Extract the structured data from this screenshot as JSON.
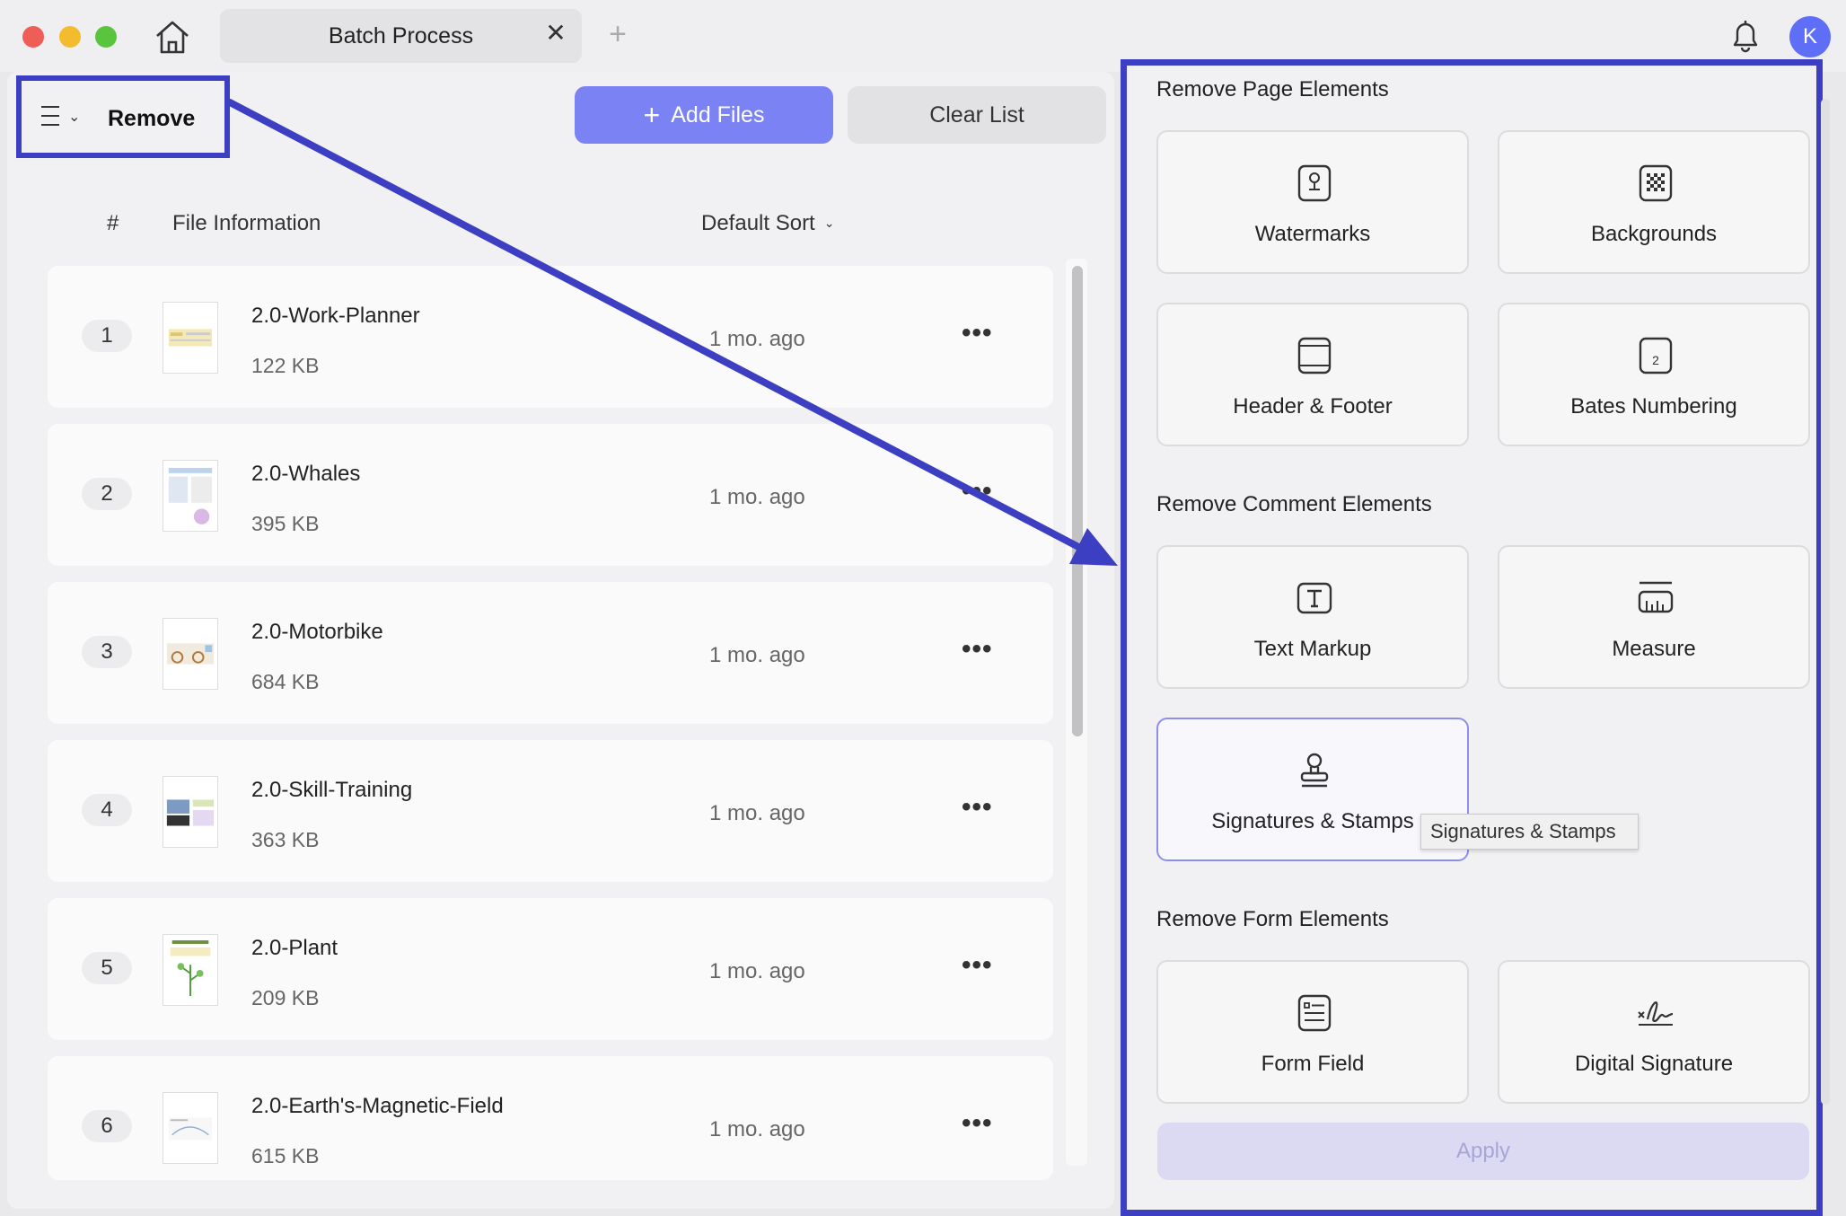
{
  "window": {
    "tab_title": "Batch Process",
    "tab_close": "✕",
    "tab_add": "+",
    "avatar_letter": "K"
  },
  "toolbar": {
    "mode_label": "Remove",
    "add_files_label": "Add Files",
    "clear_list_label": "Clear List"
  },
  "list_header": {
    "hash": "#",
    "file_info": "File Information",
    "sort": "Default Sort"
  },
  "files": [
    {
      "num": "1",
      "name": "2.0-Work-Planner",
      "size": "122 KB",
      "time": "1 mo. ago"
    },
    {
      "num": "2",
      "name": "2.0-Whales",
      "size": "395 KB",
      "time": "1 mo. ago"
    },
    {
      "num": "3",
      "name": "2.0-Motorbike",
      "size": "684 KB",
      "time": "1 mo. ago"
    },
    {
      "num": "4",
      "name": "2.0-Skill-Training",
      "size": "363 KB",
      "time": "1 mo. ago"
    },
    {
      "num": "5",
      "name": "2.0-Plant",
      "size": "209 KB",
      "time": "1 mo. ago"
    },
    {
      "num": "6",
      "name": "2.0-Earth's-Magnetic-Field",
      "size": "615 KB",
      "time": "1 mo. ago"
    }
  ],
  "right_panel": {
    "page_section": "Remove Page Elements",
    "comment_section": "Remove Comment Elements",
    "form_section": "Remove Form Elements",
    "options": {
      "watermarks": "Watermarks",
      "backgrounds": "Backgrounds",
      "header_footer": "Header & Footer",
      "bates": "Bates Numbering",
      "text_markup": "Text Markup",
      "measure": "Measure",
      "signatures": "Signatures & Stamps",
      "form_field": "Form Field",
      "digital_signature": "Digital Signature"
    },
    "tooltip": "Signatures & Stamps",
    "apply_label": "Apply"
  },
  "colors": {
    "accent": "#7b83f4",
    "annotation": "#3d3fc3",
    "apply_disabled": "#dcdaf3"
  }
}
